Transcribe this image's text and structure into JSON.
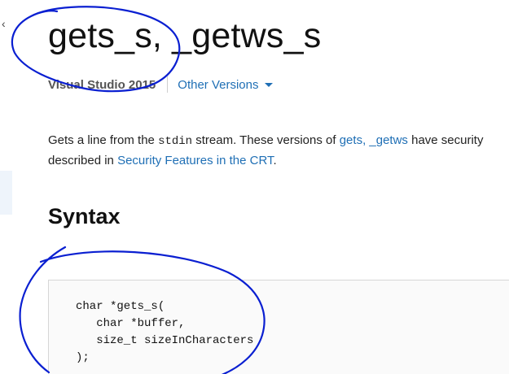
{
  "nav": {
    "back_glyph": "‹"
  },
  "header": {
    "title": "gets_s, _getws_s",
    "current_version": "Visual Studio 2015",
    "other_versions_label": "Other Versions"
  },
  "description": {
    "part1": "Gets a line from the ",
    "code_stdin": "stdin",
    "part2": " stream. These versions of ",
    "link_gets": "gets, _getws",
    "part3": " have security",
    "part4": "described in ",
    "link_security": "Security Features in the CRT",
    "part5": "."
  },
  "syntax": {
    "heading": "Syntax",
    "code_lines": [
      "char *gets_s(",
      "   char *buffer,",
      "   size_t sizeInCharacters",
      ");"
    ]
  },
  "colors": {
    "link": "#1f6fb5",
    "annotation_ink": "#0a1fd1",
    "code_background": "#fafafa"
  }
}
